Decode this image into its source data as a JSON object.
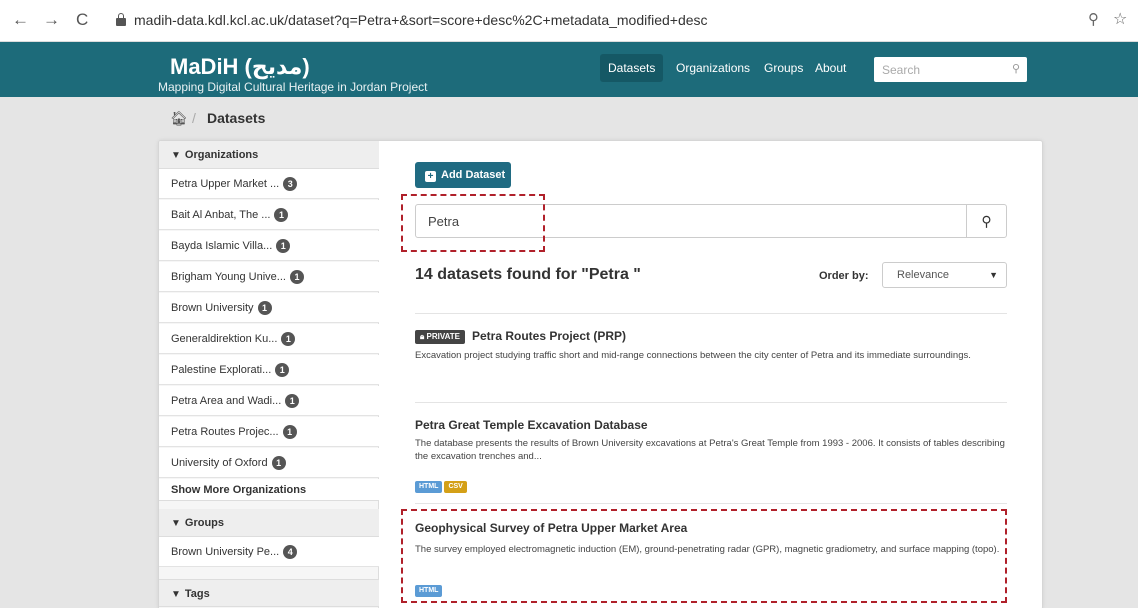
{
  "browser": {
    "url": "madih-data.kdl.kcl.ac.uk/dataset?q=Petra+&sort=score+desc%2C+metadata_modified+desc",
    "back": "←",
    "forward": "→",
    "reload": "C"
  },
  "header": {
    "title": "MaDiH (مديح)",
    "subtitle": "Mapping Digital Cultural Heritage in Jordan Project",
    "nav": [
      "Datasets",
      "Organizations",
      "Groups",
      "About"
    ],
    "search_placeholder": "Search"
  },
  "breadcrumb": {
    "current": "Datasets"
  },
  "sidebar": {
    "organizations_heading": "Organizations",
    "organizations": [
      {
        "label": "Petra Upper Market ...",
        "count": "3"
      },
      {
        "label": "Bait Al Anbat, The ...",
        "count": "1"
      },
      {
        "label": "Bayda Islamic Villa...",
        "count": "1"
      },
      {
        "label": "Brigham Young Unive...",
        "count": "1"
      },
      {
        "label": "Brown University",
        "count": "1"
      },
      {
        "label": "Generaldirektion Ku...",
        "count": "1"
      },
      {
        "label": "Palestine Explorati...",
        "count": "1"
      },
      {
        "label": "Petra Area and Wadi...",
        "count": "1"
      },
      {
        "label": "Petra Routes Projec...",
        "count": "1"
      },
      {
        "label": "University of Oxford",
        "count": "1"
      }
    ],
    "show_more": "Show More Organizations",
    "groups_heading": "Groups",
    "groups": [
      {
        "label": "Brown University Pe...",
        "count": "4"
      }
    ],
    "tags_heading": "Tags"
  },
  "main": {
    "add_dataset": "Add Dataset",
    "search_value": "Petra",
    "results_count": "14 datasets found for \"Petra \"",
    "order_by_label": "Order by:",
    "order_by_value": "Relevance",
    "datasets": [
      {
        "private_label": "PRIVATE",
        "title": "Petra Routes Project (PRP)",
        "description": "Excavation project studying traffic short and mid-range connections between the city center of Petra and its immediate surroundings."
      },
      {
        "title": "Petra Great Temple Excavation Database",
        "description": "The database presents the results of Brown University excavations at Petra's Great Temple from 1993 - 2006. It consists of tables describing the excavation trenches and...",
        "formats": [
          "HTML",
          "CSV"
        ]
      },
      {
        "title": "Geophysical Survey of Petra Upper Market Area",
        "description": "The survey employed electromagnetic induction (EM), ground-penetrating radar (GPR), magnetic gradiometry, and surface mapping (topo).",
        "formats": [
          "HTML"
        ]
      }
    ]
  },
  "colors": {
    "masthead": "#1d6b7a",
    "button": "#206b82",
    "html_badge": "#5b9bd5",
    "csv_badge": "#d4a017",
    "highlight": "#b0202a"
  }
}
